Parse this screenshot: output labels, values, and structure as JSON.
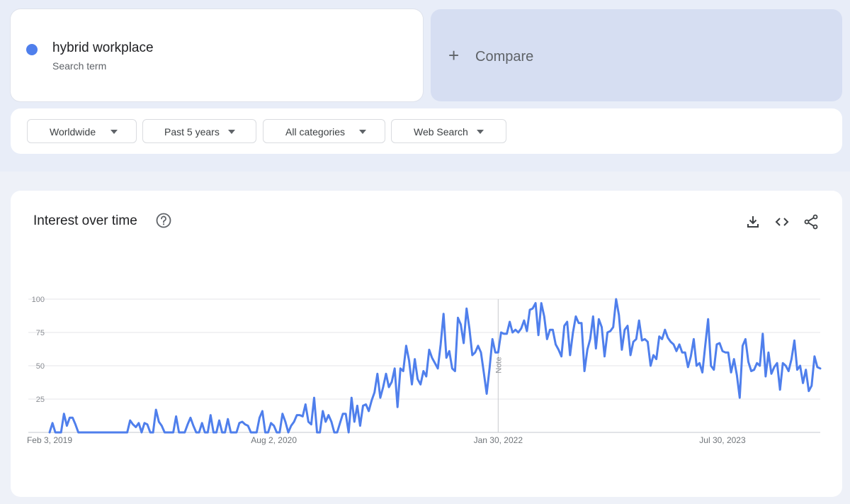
{
  "search_term": {
    "name": "hybrid workplace",
    "subtitle": "Search term",
    "color": "#4f7fec"
  },
  "compare": {
    "label": "Compare",
    "icon": "plus-icon"
  },
  "filters": [
    {
      "label": "Worldwide"
    },
    {
      "label": "Past 5 years"
    },
    {
      "label": "All categories"
    },
    {
      "label": "Web Search"
    }
  ],
  "interest_over_time": {
    "title": "Interest over time",
    "icons": [
      "help-icon",
      "download-icon",
      "embed-icon",
      "share-icon"
    ]
  },
  "chart_data": {
    "type": "line",
    "title": "",
    "xlabel": "",
    "ylabel": "",
    "ylim": [
      0,
      100
    ],
    "y_ticks": [
      25,
      50,
      75,
      100
    ],
    "x_ticks": [
      "Feb 3, 2019",
      "Aug 2, 2020",
      "Jan 30, 2022",
      "Jul 30, 2023"
    ],
    "x_tick_weeks": [
      0,
      78,
      156,
      234
    ],
    "grid": true,
    "note_marker": {
      "label": "Note",
      "week": 156
    },
    "series": [
      {
        "name": "hybrid workplace",
        "color": "#4f7fec",
        "values": [
          0,
          7,
          0,
          0,
          0,
          14,
          5,
          11,
          11,
          6,
          0,
          0,
          0,
          0,
          0,
          0,
          0,
          0,
          0,
          0,
          0,
          0,
          0,
          0,
          0,
          0,
          0,
          0,
          9,
          6,
          4,
          7,
          0,
          7,
          6,
          0,
          0,
          17,
          8,
          5,
          0,
          0,
          0,
          0,
          12,
          0,
          0,
          0,
          6,
          11,
          5,
          0,
          0,
          7,
          0,
          0,
          13,
          0,
          0,
          9,
          0,
          0,
          10,
          0,
          0,
          0,
          7,
          8,
          6,
          5,
          0,
          0,
          0,
          11,
          16,
          0,
          0,
          7,
          5,
          0,
          0,
          14,
          8,
          0,
          5,
          8,
          13,
          13,
          12,
          21,
          8,
          6,
          26,
          0,
          0,
          16,
          8,
          13,
          8,
          0,
          0,
          7,
          14,
          14,
          0,
          26,
          8,
          20,
          5,
          20,
          21,
          16,
          24,
          30,
          44,
          26,
          34,
          44,
          34,
          38,
          48,
          19,
          48,
          46,
          65,
          54,
          36,
          55,
          40,
          36,
          46,
          42,
          62,
          56,
          52,
          48,
          66,
          89,
          56,
          61,
          48,
          46,
          86,
          81,
          67,
          93,
          78,
          58,
          60,
          65,
          60,
          45,
          29,
          48,
          70,
          60,
          60,
          75,
          74,
          74,
          83,
          75,
          77,
          75,
          78,
          84,
          76,
          92,
          93,
          97,
          73,
          97,
          87,
          70,
          77,
          77,
          66,
          62,
          57,
          80,
          83,
          58,
          75,
          87,
          82,
          82,
          46,
          62,
          70,
          87,
          63,
          85,
          79,
          57,
          75,
          76,
          79,
          100,
          88,
          62,
          77,
          80,
          58,
          68,
          70,
          84,
          69,
          70,
          68,
          50,
          58,
          55,
          72,
          70,
          77,
          71,
          68,
          66,
          61,
          66,
          60,
          60,
          49,
          57,
          70,
          50,
          52,
          45,
          65,
          85,
          50,
          47,
          66,
          67,
          61,
          60,
          60,
          45,
          55,
          43,
          26,
          65,
          70,
          53,
          46,
          47,
          52,
          50,
          74,
          42,
          60,
          44,
          49,
          52,
          32,
          52,
          50,
          46,
          55,
          69,
          47,
          50,
          37,
          47,
          31,
          35,
          57,
          49,
          48
        ]
      }
    ]
  }
}
